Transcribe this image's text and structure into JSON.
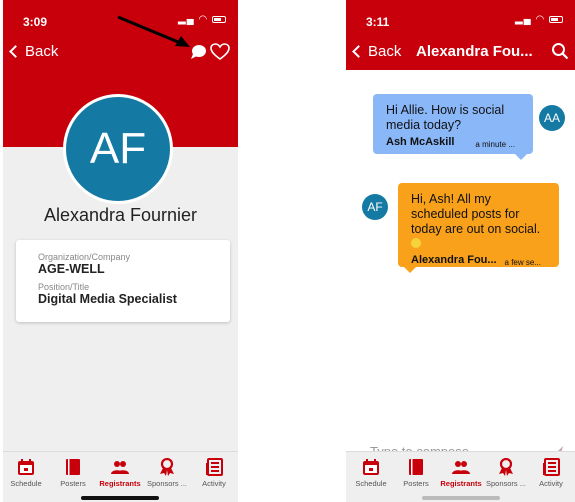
{
  "left": {
    "status_time": "3:09",
    "back_label": "Back",
    "avatar_initials": "AF",
    "name": "Alexandra Fournier",
    "fields": [
      {
        "label": "Organization/Company",
        "value": "AGE-WELL"
      },
      {
        "label": "Position/Title",
        "value": "Digital Media Specialist"
      }
    ]
  },
  "right": {
    "status_time": "3:11",
    "back_label": "Back",
    "title": "Alexandra Fou...",
    "messages": [
      {
        "text": "Hi Allie. How is social media today?",
        "sender": "Ash McAskill",
        "time": "a minute ...",
        "avatar": "AA"
      },
      {
        "text": "Hi, Ash! All my scheduled posts for today are out on social.",
        "sender": "Alexandra Fou...",
        "time": "a few se...",
        "avatar": "AF"
      }
    ],
    "compose_placeholder": "Type to compose"
  },
  "tabs": [
    {
      "label": "Schedule",
      "icon": "calendar-icon"
    },
    {
      "label": "Posters",
      "icon": "book-icon"
    },
    {
      "label": "Registrants",
      "icon": "people-icon",
      "active": true
    },
    {
      "label": "Sponsors ...",
      "icon": "award-icon"
    },
    {
      "label": "Activity",
      "icon": "newspaper-icon"
    }
  ],
  "colors": {
    "brand_red": "#c8000b",
    "avatar_blue": "#157aa3",
    "bubble_blue": "#8ab7f8",
    "bubble_orange": "#f9a11b"
  }
}
